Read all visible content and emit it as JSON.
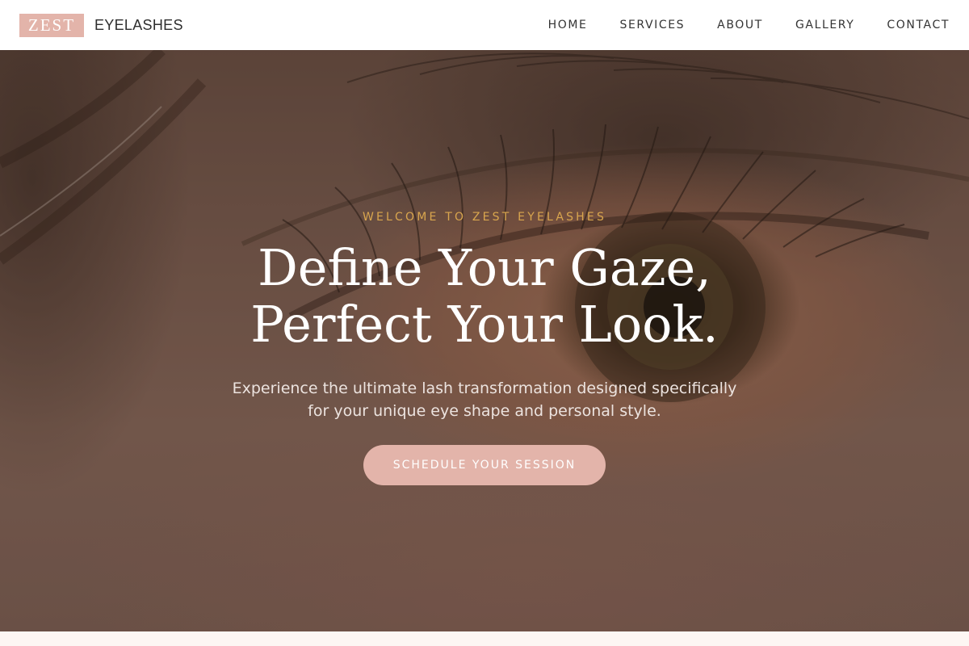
{
  "brand": {
    "logo_mark": "ZEST",
    "logo_name": "EYELASHES",
    "accent_color": "#e3b4aa",
    "gold_color": "#d9a64e"
  },
  "nav": {
    "items": [
      {
        "label": "HOME"
      },
      {
        "label": "SERVICES"
      },
      {
        "label": "ABOUT"
      },
      {
        "label": "GALLERY"
      },
      {
        "label": "CONTACT"
      }
    ]
  },
  "hero": {
    "eyebrow": "WELCOME TO ZEST EYELASHES",
    "headline_line1": "Define Your Gaze,",
    "headline_line2": "Perfect Your Look.",
    "subtext_line1": "Experience the ultimate lash transformation designed specifically",
    "subtext_line2": "for your unique eye shape and personal style.",
    "cta_label": "SCHEDULE YOUR SESSION",
    "background_image": "close-up eye photograph"
  }
}
